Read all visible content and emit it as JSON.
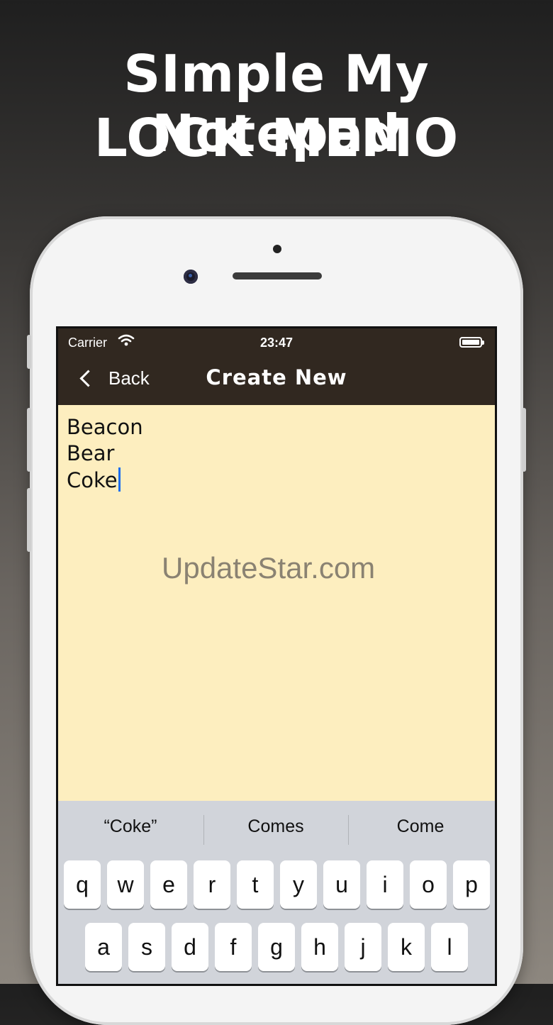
{
  "promo": {
    "line1": "SImple My Notepad",
    "line2": "LOCK MEMO"
  },
  "status_bar": {
    "carrier": "Carrier",
    "time": "23:47",
    "wifi_icon": "wifi-icon",
    "battery_icon": "battery-icon"
  },
  "nav": {
    "back_label": "Back",
    "title": "Create New"
  },
  "editor": {
    "lines": [
      "Beacon",
      "Bear",
      "Coke"
    ]
  },
  "watermark": "UpdateStar.com",
  "keyboard": {
    "suggestions": [
      "“Coke”",
      "Comes",
      "Come"
    ],
    "row1": [
      "q",
      "w",
      "e",
      "r",
      "t",
      "y",
      "u",
      "i",
      "o",
      "p"
    ],
    "row2": [
      "a",
      "s",
      "d",
      "f",
      "g",
      "h",
      "j",
      "k",
      "l"
    ]
  },
  "colors": {
    "navbar": "#312820",
    "editor_bg": "#fdeebf",
    "caret": "#1a6df0"
  }
}
